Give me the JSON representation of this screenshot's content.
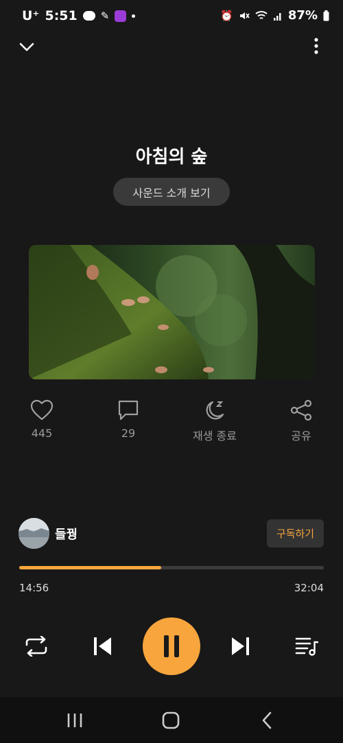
{
  "status_bar": {
    "carrier": "U⁺",
    "time": "5:51",
    "battery": "87%"
  },
  "header": {
    "collapse_icon": "chevron-down-icon",
    "menu_icon": "more-vertical-icon"
  },
  "track": {
    "title": "아침의 숲",
    "intro_button": "사운드 소개 보기"
  },
  "actions": [
    {
      "icon": "heart-icon",
      "label": "445"
    },
    {
      "icon": "comment-icon",
      "label": "29"
    },
    {
      "icon": "sleep-moon-icon",
      "label": "재생 종료"
    },
    {
      "icon": "share-icon",
      "label": "공유"
    }
  ],
  "channel": {
    "name": "들꿩",
    "subscribe_label": "구독하기"
  },
  "progress": {
    "elapsed": "14:56",
    "total": "32:04",
    "fraction": 0.466
  },
  "controls": {
    "repeat": "repeat-icon",
    "previous": "skip-previous-icon",
    "pause": "pause-icon",
    "next": "skip-next-icon",
    "playlist": "playlist-icon"
  },
  "colors": {
    "background": "#181818",
    "accent": "#f7a53c"
  }
}
